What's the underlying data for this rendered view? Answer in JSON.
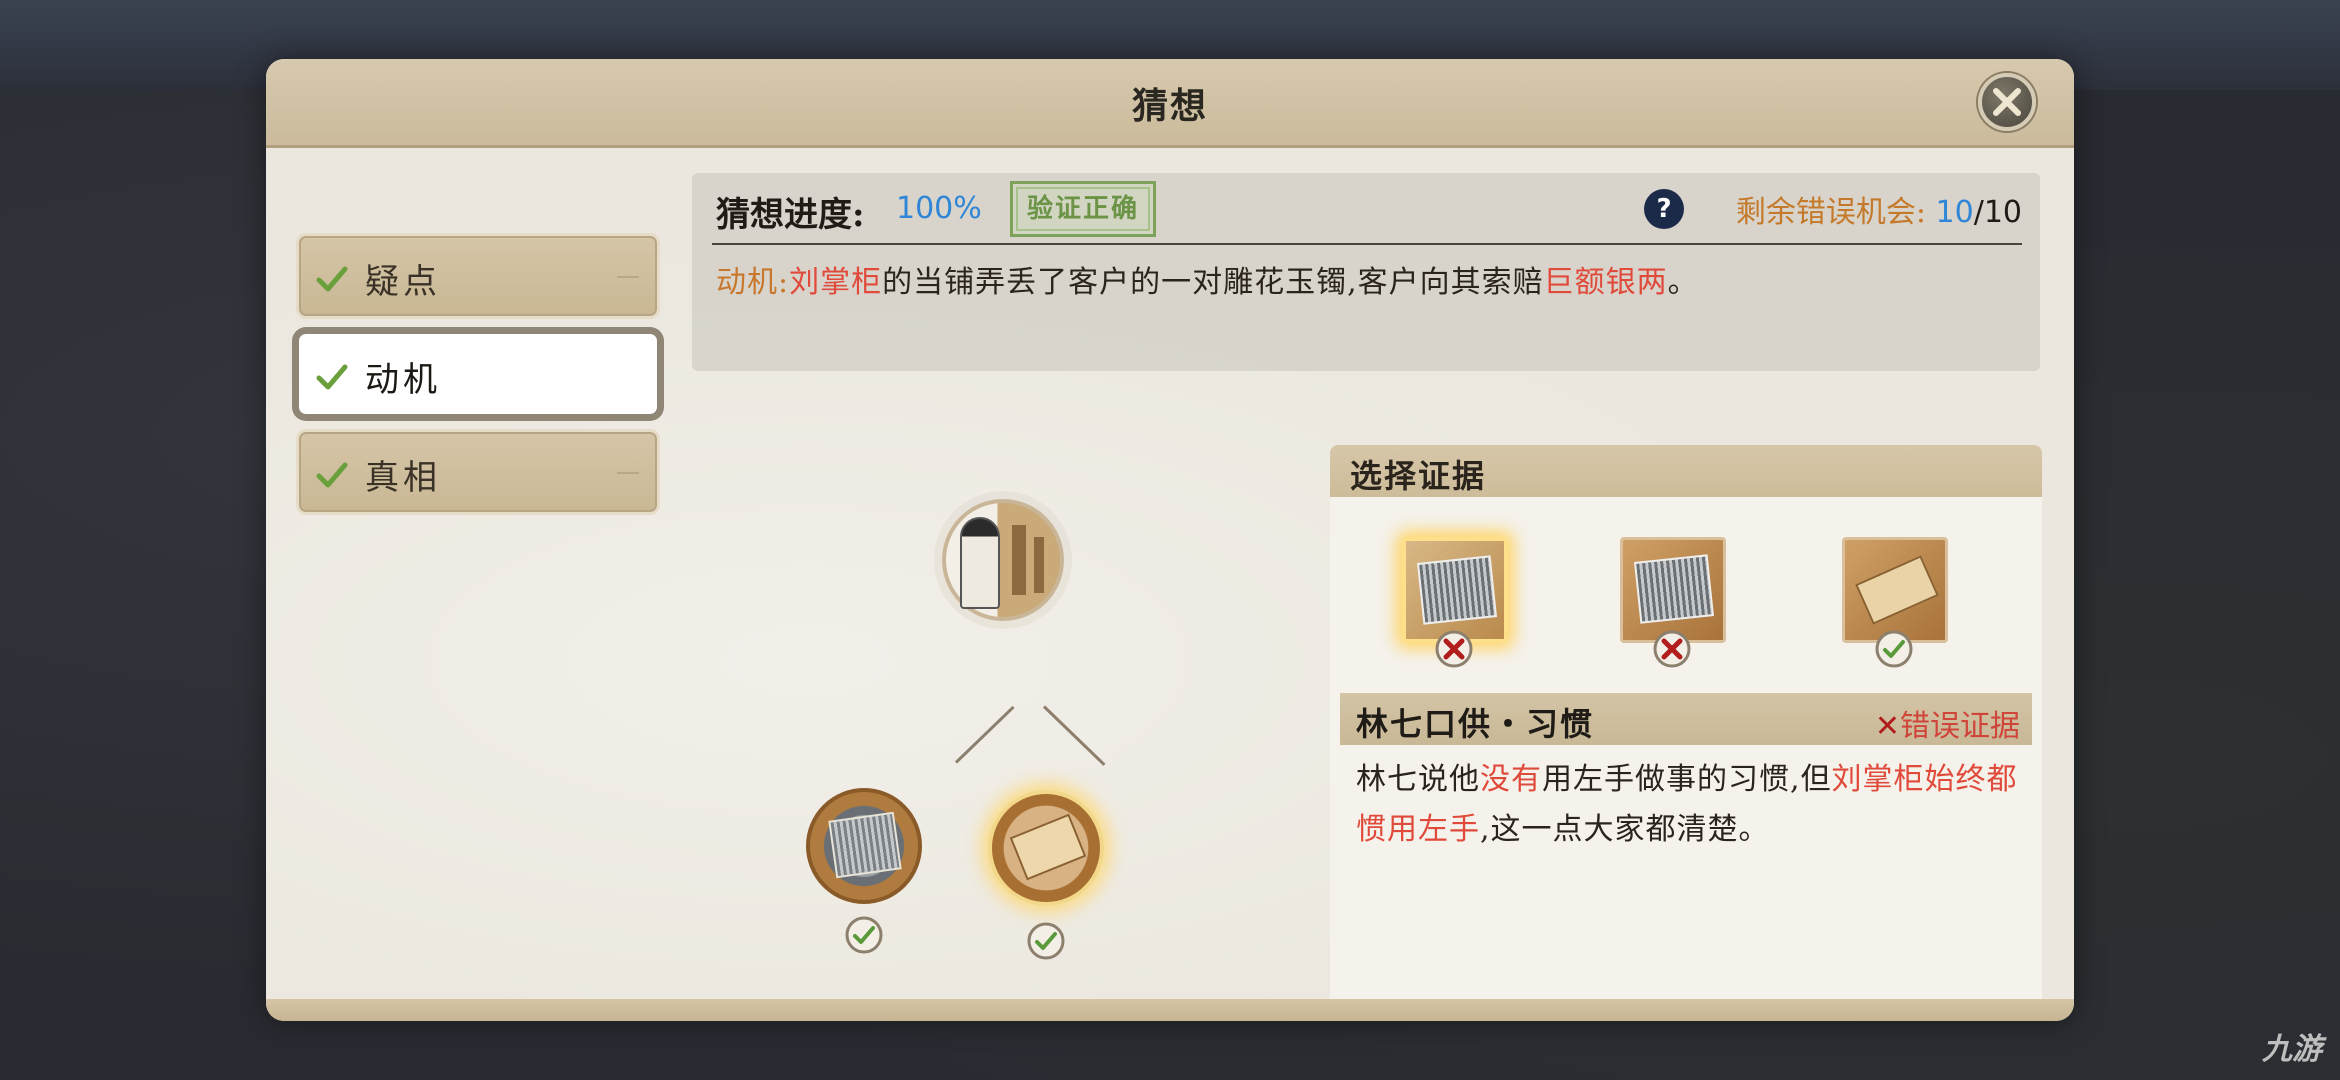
{
  "dialog": {
    "title": "猜想"
  },
  "tabs": [
    {
      "label": "疑点",
      "checked": true,
      "active": false
    },
    {
      "label": "动机",
      "checked": true,
      "active": true
    },
    {
      "label": "真相",
      "checked": true,
      "active": false
    }
  ],
  "progress": {
    "label": "猜想进度:",
    "value": "100%",
    "stamp": "验证正确",
    "help_icon": "?",
    "chances_label": "剩余错误机会:",
    "chances_current": "10",
    "chances_total": "/10"
  },
  "motive": {
    "prefix": "动机:",
    "name": "刘掌柜",
    "text1": "的当铺弄丢了客户的一对雕花玉镯,客户向其索赔",
    "highlight": "巨额银两",
    "end": "。"
  },
  "evidence": {
    "header": "选择证据",
    "items": [
      {
        "icon": "document-stack-icon",
        "result": "wrong",
        "selected": true
      },
      {
        "icon": "document-stack-icon",
        "result": "wrong",
        "selected": false
      },
      {
        "icon": "scroll-icon",
        "result": "correct",
        "selected": false
      }
    ],
    "testimony_name": "林七口供・习惯",
    "verdict_mark": "✕",
    "verdict_label": "错误证据",
    "text_a": "林七说他",
    "text_b": "没有",
    "text_c": "用左手做事的习惯,但",
    "text_d": "刘掌柜始终都惯用左手",
    "text_e": ",这一点大家都清楚。"
  },
  "diagram": {
    "top_node": "character-portrait-icon",
    "left_node": "document-stack-icon",
    "right_node": "scroll-icon",
    "left_checked": true,
    "right_checked": true
  },
  "watermark": "九游",
  "colors": {
    "accent_blue": "#2f86d6",
    "accent_orange": "#c7782c",
    "accent_red": "#e04a3a",
    "check_green": "#6aa03c"
  }
}
